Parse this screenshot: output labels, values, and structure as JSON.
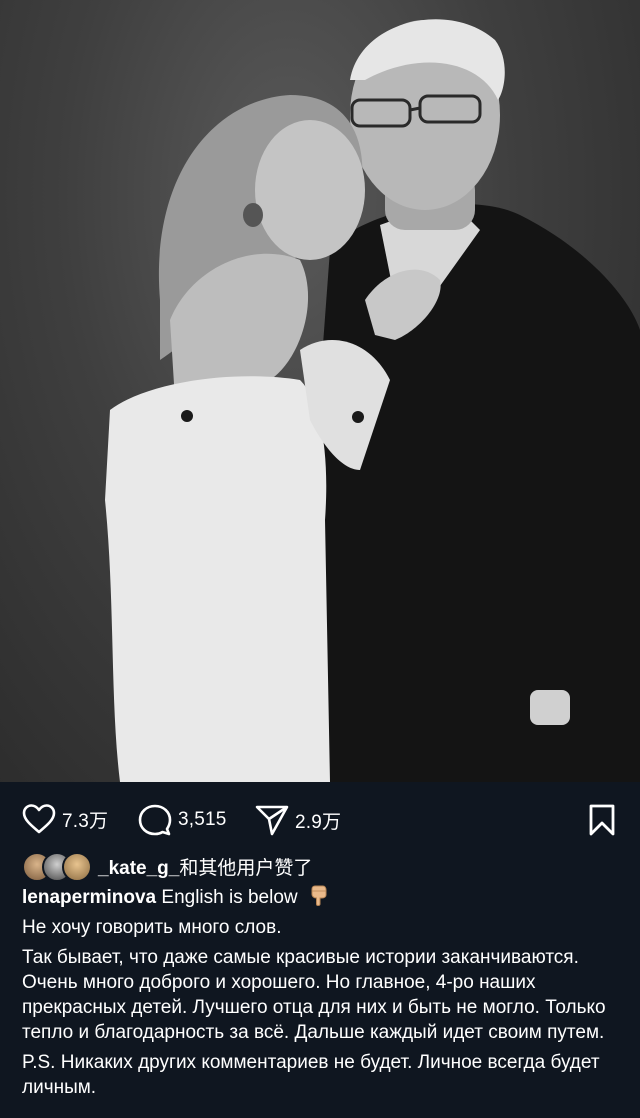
{
  "post": {
    "photo_alt": "black-and-white portrait photo",
    "actions": {
      "likes": "7.3万",
      "comments": "3,515",
      "shares": "2.9万"
    },
    "liked_by": {
      "user": "_kate_g_",
      "rest": "和其他用户赞了"
    },
    "caption": {
      "username": "lenaperminova",
      "first_line": "English is below",
      "pointing_emoji": "pointing-down-emoji",
      "paragraphs": [
        "Не хочу говорить много слов.",
        "Так бывает, что даже самые красивые истории заканчиваются. Очень много доброго и хорошего. Но главное, 4-ро наших прекрасных детей. Лучшего отца для них и быть не могло. Только тепло и благодарность за всё. Дальше каждый идет своим путем.",
        "P.S. Никаких других комментариев не будет. Личное всегда будет личным."
      ]
    },
    "colors": {
      "background": "#0f1620",
      "text": "#ffffff"
    }
  }
}
